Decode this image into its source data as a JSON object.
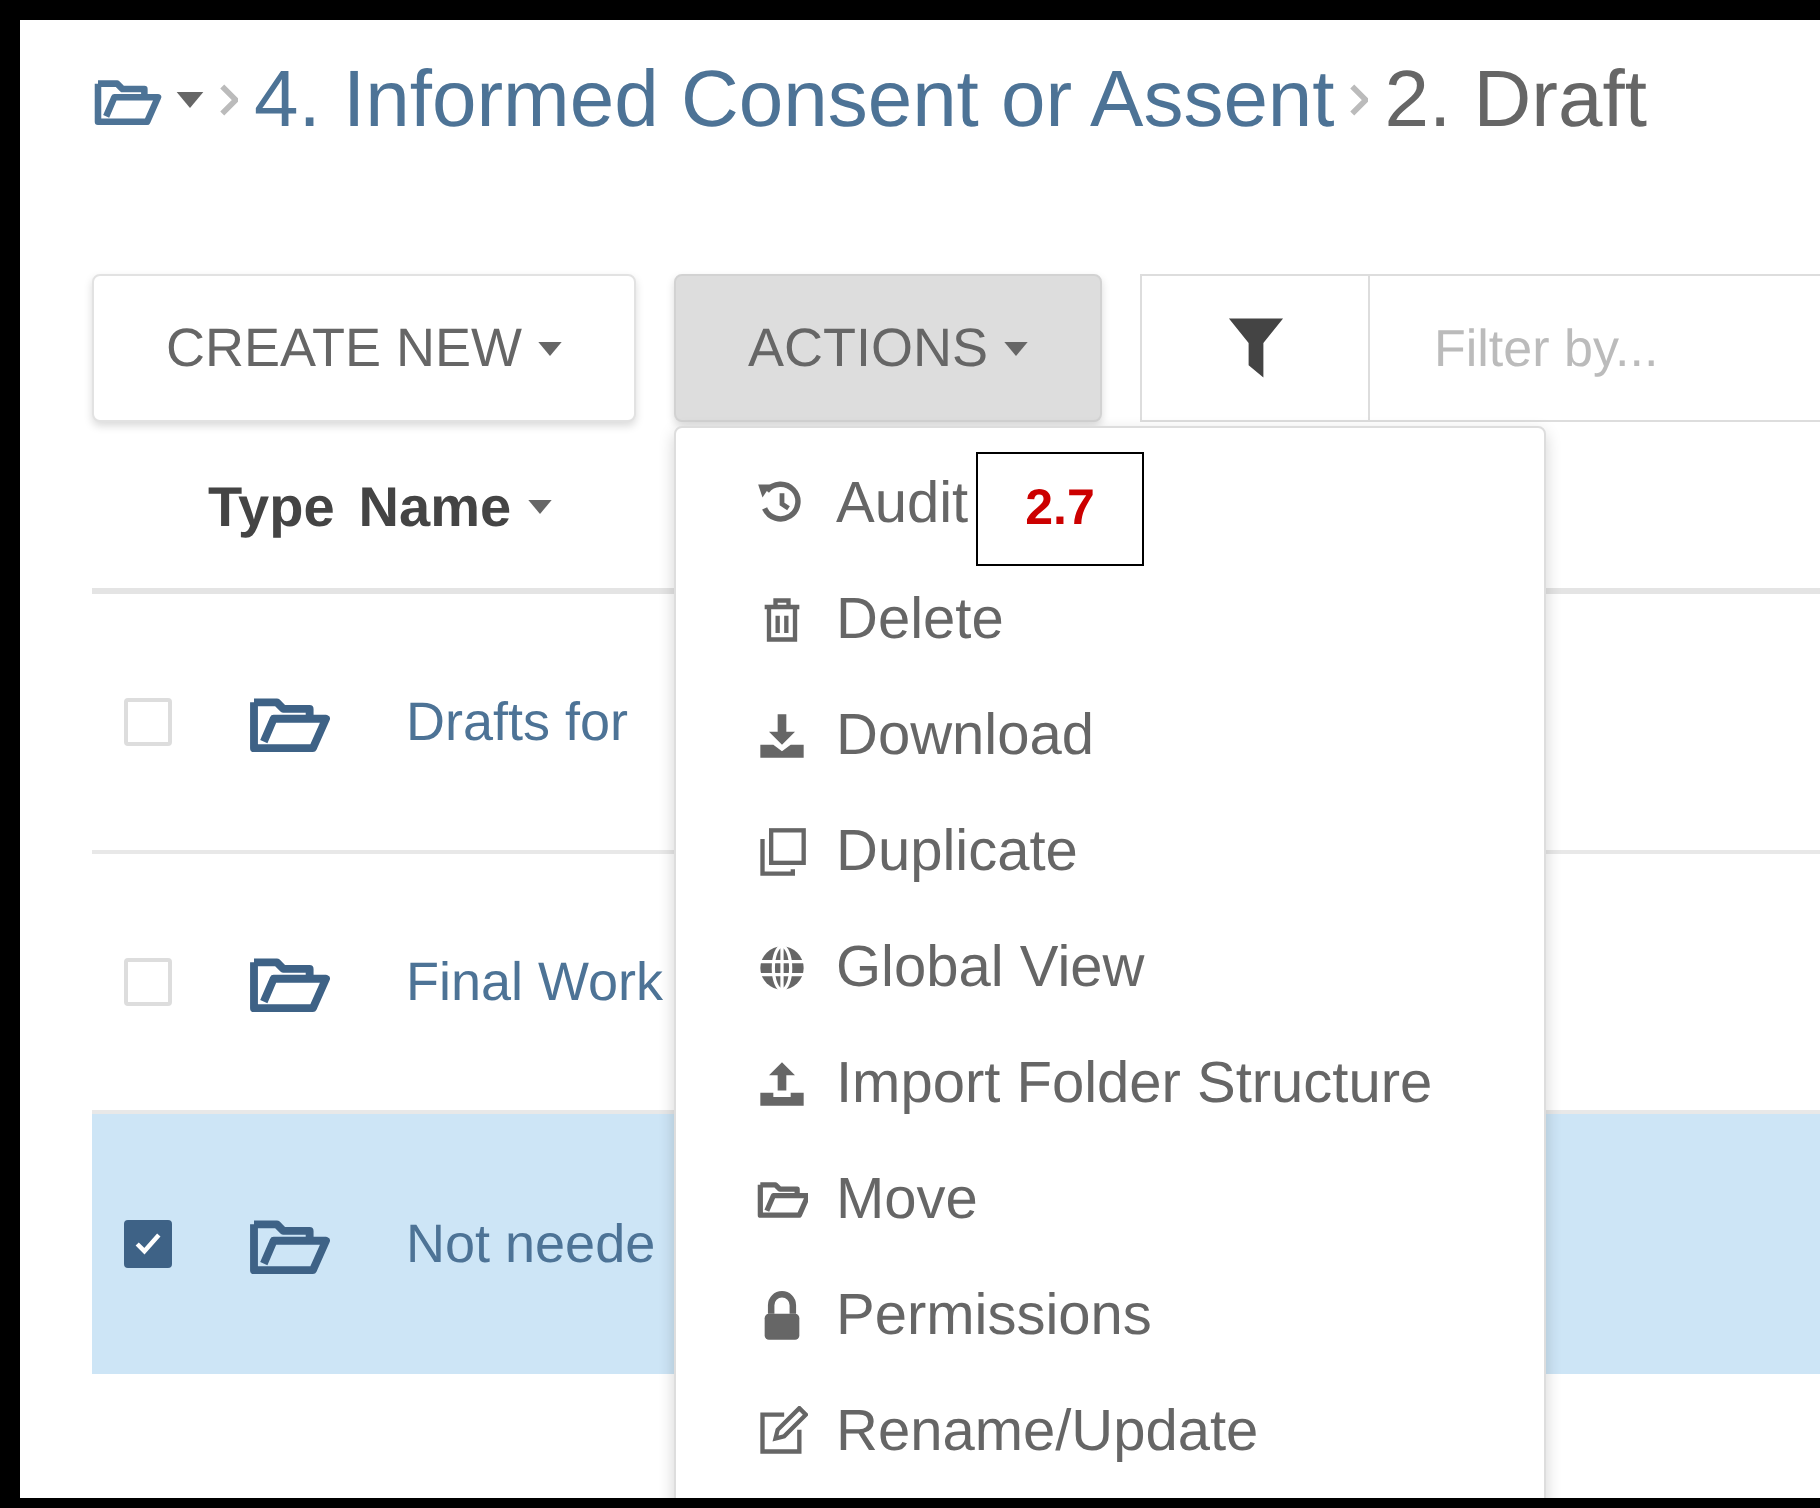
{
  "breadcrumb": {
    "items": [
      {
        "text": "4. Informed Consent or Assent",
        "kind": "link"
      },
      {
        "text": "2. Draft",
        "kind": "current"
      }
    ]
  },
  "toolbar": {
    "create_button": "CREATE NEW",
    "actions_button": {
      "label": "ACTIONS",
      "expanded": true
    },
    "filter": {
      "placeholder": "Filter by..."
    }
  },
  "actions_menu": [
    {
      "label": "Audit"
    },
    {
      "label": "Delete"
    },
    {
      "label": "Download"
    },
    {
      "label": "Duplicate"
    },
    {
      "label": "Global View"
    },
    {
      "label": "Import Folder Structure"
    },
    {
      "label": "Move"
    },
    {
      "label": "Permissions"
    },
    {
      "label": "Rename/Update"
    }
  ],
  "annotation": {
    "text": "2.7"
  },
  "table": {
    "columns": [
      {
        "label": "Type",
        "sorted": false
      },
      {
        "label": "Name",
        "sorted": true
      }
    ],
    "rows": [
      {
        "name": "Drafts for",
        "selected": false
      },
      {
        "name": "Final Work",
        "selected": false
      },
      {
        "name": "Not neede",
        "selected": true
      }
    ]
  }
}
